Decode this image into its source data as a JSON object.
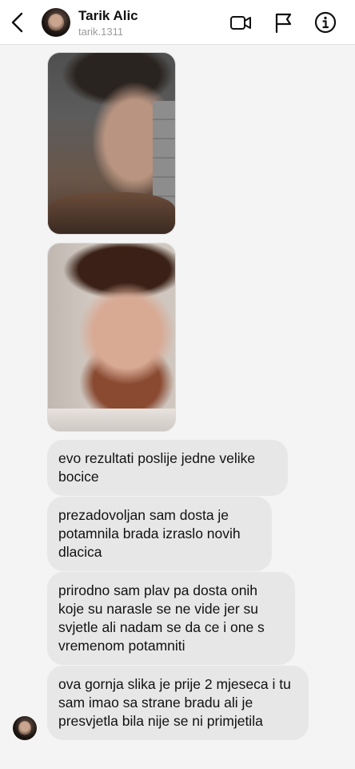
{
  "header": {
    "contact_name": "Tarik Alic",
    "contact_username": "tarik.1311",
    "icons": [
      "back-icon",
      "video-call-icon",
      "flag-icon",
      "info-icon"
    ]
  },
  "messages": [
    {
      "type": "image",
      "description_icon": "photo-message"
    },
    {
      "type": "image",
      "description_icon": "photo-message"
    },
    {
      "type": "text",
      "text": "evo rezultati poslije jedne velike bocice"
    },
    {
      "type": "text",
      "text": "prezadovoljan sam dosta je potamnila brada izraslo novih dlacica"
    },
    {
      "type": "text",
      "text": "prirodno sam plav pa dosta onih koje su narasle se ne vide jer su svjetle ali nadam se da ce i one s vremenom potamniti"
    },
    {
      "type": "text",
      "text": "ova gornja slika je prije 2 mjeseca i tu sam imao sa strane bradu ali je presvjetla bila nije se ni primjetila"
    }
  ],
  "colors": {
    "background": "#f4f4f4",
    "bubble": "#e7e7e7",
    "header": "#ffffff",
    "text": "#111111",
    "muted": "#9a9a9a"
  }
}
